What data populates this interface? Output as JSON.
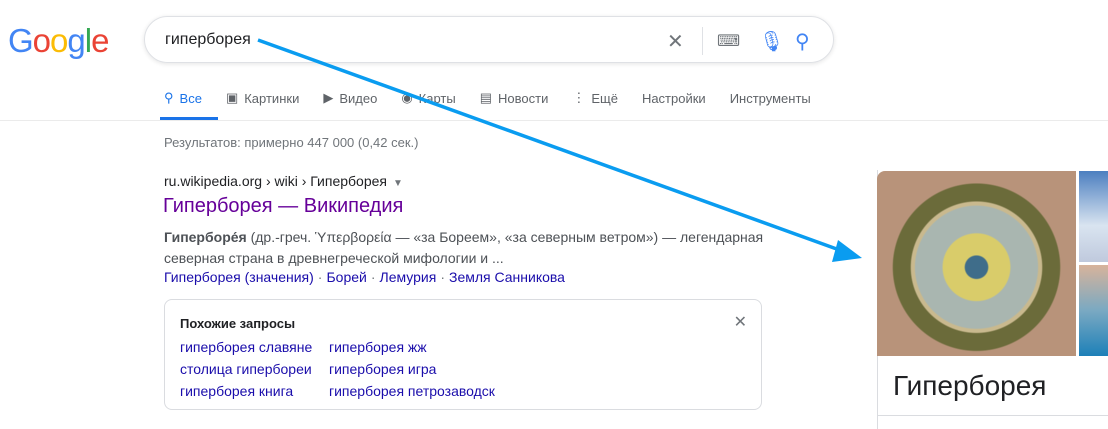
{
  "logo": "Google",
  "search": {
    "query": "гиперборея"
  },
  "tabs": [
    {
      "label": "Все"
    },
    {
      "label": "Картинки"
    },
    {
      "label": "Видео"
    },
    {
      "label": "Карты"
    },
    {
      "label": "Новости"
    },
    {
      "label": "Ещё"
    },
    {
      "label": "Настройки"
    },
    {
      "label": "Инструменты"
    }
  ],
  "stats": "Результатов: примерно 447 000 (0,42 сек.)",
  "result": {
    "breadcrumb": "ru.wikipedia.org › wiki › Гиперборея",
    "title": "Гиперборея — Википедия",
    "snippet_bold": "Гиперборе́я",
    "snippet": " (др.-греч. Ὑπερβορεία — «за Бореем», «за северным ветром») — легендарная северная страна в древнегреческой мифологии и ...",
    "links": [
      "Гиперборея (значения)",
      "Борей",
      "Лемурия",
      "Земля Санникова"
    ]
  },
  "related": {
    "heading": "Похожие запросы",
    "col1": [
      "гиперборея славяне",
      "столица гипербореи",
      "гиперборея книга"
    ],
    "col2": [
      "гиперборея жж",
      "гиперборея игра",
      "гиперборея петрозаводск"
    ]
  },
  "knowledge_panel": {
    "title": "Гиперборея"
  },
  "colors": {
    "accent": "#1a73e8",
    "visited": "#660099",
    "link": "#1a0dab",
    "arrow": "#0a9cf0"
  }
}
